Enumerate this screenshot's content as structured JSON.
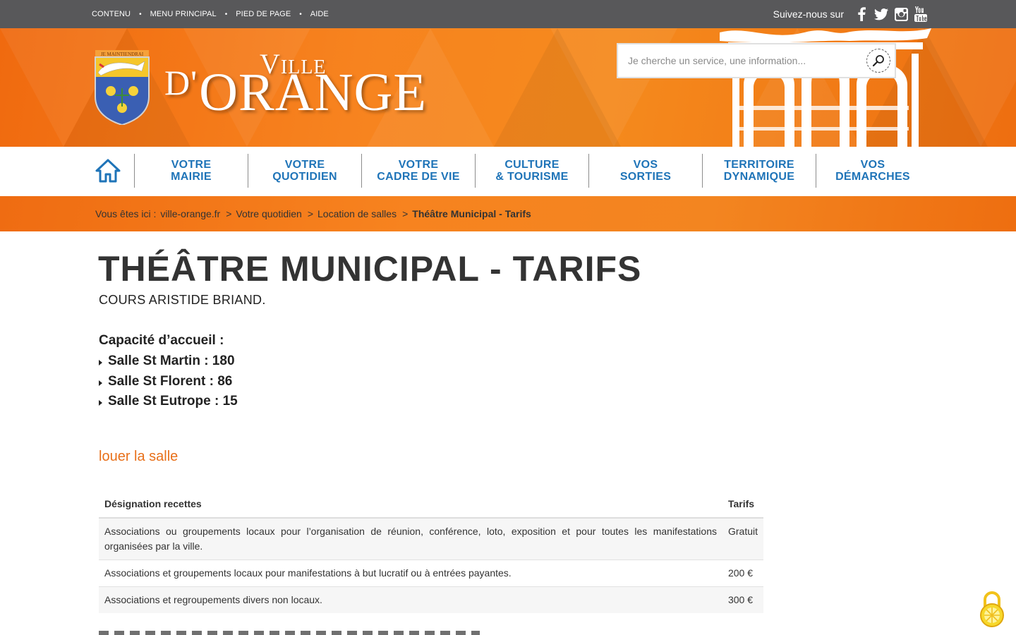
{
  "topbar": {
    "skip_links": [
      "CONTENU",
      "MENU PRINCIPAL",
      "PIED DE PAGE",
      "AIDE"
    ],
    "follow_label": "Suivez-nous sur",
    "social_icons": [
      "facebook-icon",
      "twitter-icon",
      "instagram-icon",
      "youtube-icon"
    ]
  },
  "header": {
    "logo_ville": "Ville",
    "logo_d": "D'",
    "logo_orange": "ORANGE",
    "crest_motto": "JE MAINTIENDRAI",
    "search_placeholder": "Je cherche un service, une information..."
  },
  "nav": {
    "home_icon": "home-icon",
    "items": [
      {
        "line1": "Votre",
        "line2": "Mairie"
      },
      {
        "line1": "Votre",
        "line2": "Quotidien"
      },
      {
        "line1": "Votre",
        "line2": "Cadre de vie"
      },
      {
        "line1": "Culture",
        "line2": "& Tourisme"
      },
      {
        "line1": "Vos",
        "line2": "Sorties"
      },
      {
        "line1": "Territoire",
        "line2": "Dynamique"
      },
      {
        "line1": "Vos",
        "line2": "Démarches"
      }
    ]
  },
  "breadcrumb": {
    "prefix": "Vous êtes ici :",
    "links": [
      "ville-orange.fr",
      "Votre quotidien",
      "Location de salles"
    ],
    "current": "Théâtre Municipal - Tarifs",
    "separator": ">"
  },
  "content": {
    "title": "THÉÂTRE MUNICIPAL - TARIFS",
    "subtitle": "COURS ARISTIDE BRIAND.",
    "capacity_title": "Capacité d’accueil :",
    "capacity_items": [
      "Salle St Martin : 180",
      "Salle St Florent : 86",
      "Salle St Eutrope : 15"
    ],
    "rent_link": "louer la salle"
  },
  "table": {
    "headers": [
      "Désignation recettes",
      "Tarifs"
    ],
    "rows": [
      {
        "desc": "Associations ou groupements locaux pour l’organisation de réunion, conférence, loto, exposition et pour toutes les manifestations organisées par la ville.",
        "price": "Gratuit"
      },
      {
        "desc": "Associations et groupements locaux pour manifestations à but lucratif ou à entrées payantes.",
        "price": "200 €"
      },
      {
        "desc": "Associations et regroupements divers non locaux.",
        "price": "300 €"
      }
    ]
  },
  "colors": {
    "topbar": "#58585a",
    "orange": "#f7831f",
    "nav_text": "#1f74b8",
    "link": "#e8701a"
  },
  "accessibility_icon": "lock-icon"
}
